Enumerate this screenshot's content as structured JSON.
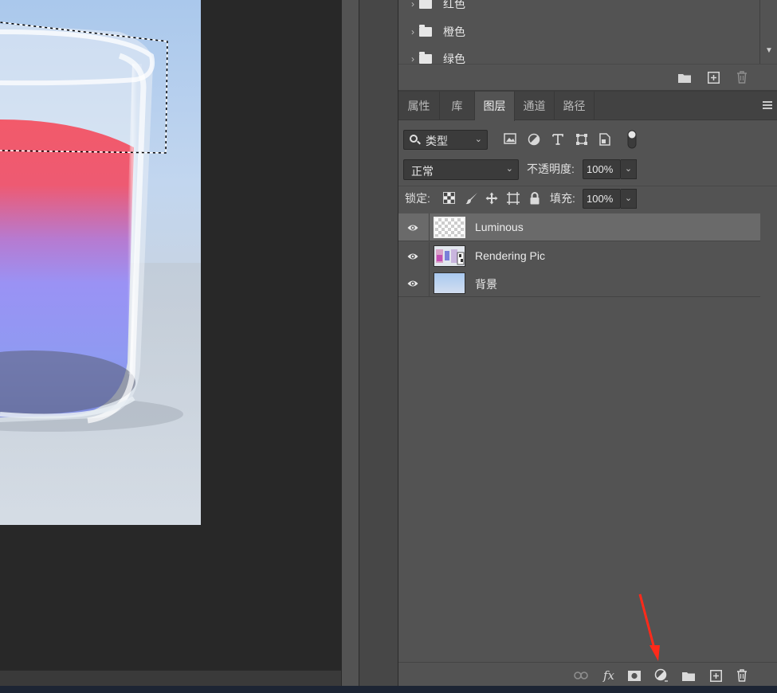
{
  "swatches": {
    "groups": [
      {
        "name": "红色"
      },
      {
        "name": "橙色"
      },
      {
        "name": "绿色"
      }
    ],
    "footer_icons": [
      "new-group-folder-icon",
      "new-swatch-icon",
      "delete-swatch-icon"
    ]
  },
  "layers_panel": {
    "tabs": [
      {
        "label": "属性",
        "active": false
      },
      {
        "label": "库",
        "active": false
      },
      {
        "label": "图层",
        "active": true
      },
      {
        "label": "通道",
        "active": false
      },
      {
        "label": "路径",
        "active": false
      }
    ],
    "filter": {
      "kind_label": "类型",
      "icons": [
        "pixel-filter-icon",
        "adjustment-filter-icon",
        "type-filter-icon",
        "shape-filter-icon",
        "smart-object-filter-icon",
        "filter-toggle-icon"
      ]
    },
    "blend_mode": "正常",
    "opacity_label": "不透明度:",
    "opacity_value": "100%",
    "lock_label": "锁定:",
    "fill_label": "填充:",
    "fill_value": "100%",
    "layers": [
      {
        "name": "Luminous",
        "visible": true,
        "selected": true
      },
      {
        "name": "Rendering Pic",
        "visible": true,
        "selected": false
      },
      {
        "name": "背景",
        "visible": true,
        "selected": false
      }
    ],
    "footer_icons": [
      "link-layers-icon",
      "fx-icon",
      "add-mask-icon",
      "new-adjustment-layer-icon",
      "new-group-icon",
      "new-layer-icon",
      "delete-layer-icon"
    ],
    "fx_label": "fx"
  },
  "colors": {
    "panel_bg": "#535353",
    "selected_row": "#6a6a6a",
    "annotation_arrow": "#ff2a1a"
  }
}
